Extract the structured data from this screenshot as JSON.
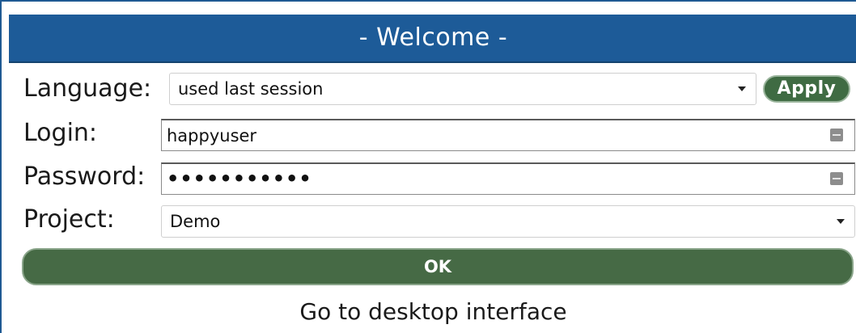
{
  "header": {
    "title": "- Welcome -"
  },
  "form": {
    "language": {
      "label": "Language:",
      "value": "used last session",
      "apply_label": "Apply"
    },
    "login": {
      "label": "Login:",
      "value": "happyuser"
    },
    "password": {
      "label": "Password:",
      "masked_value": "•••••••••••"
    },
    "project": {
      "label": "Project:",
      "value": "Demo"
    },
    "ok_label": "OK"
  },
  "footer": {
    "desktop_link": "Go to desktop interface"
  },
  "colors": {
    "header_bg": "#1d5b98",
    "button_green": "#466a45",
    "frame_border": "#1f5a93"
  },
  "icons": {
    "select_caret": "chevron-down-icon",
    "field_key": "password-manager-icon"
  }
}
